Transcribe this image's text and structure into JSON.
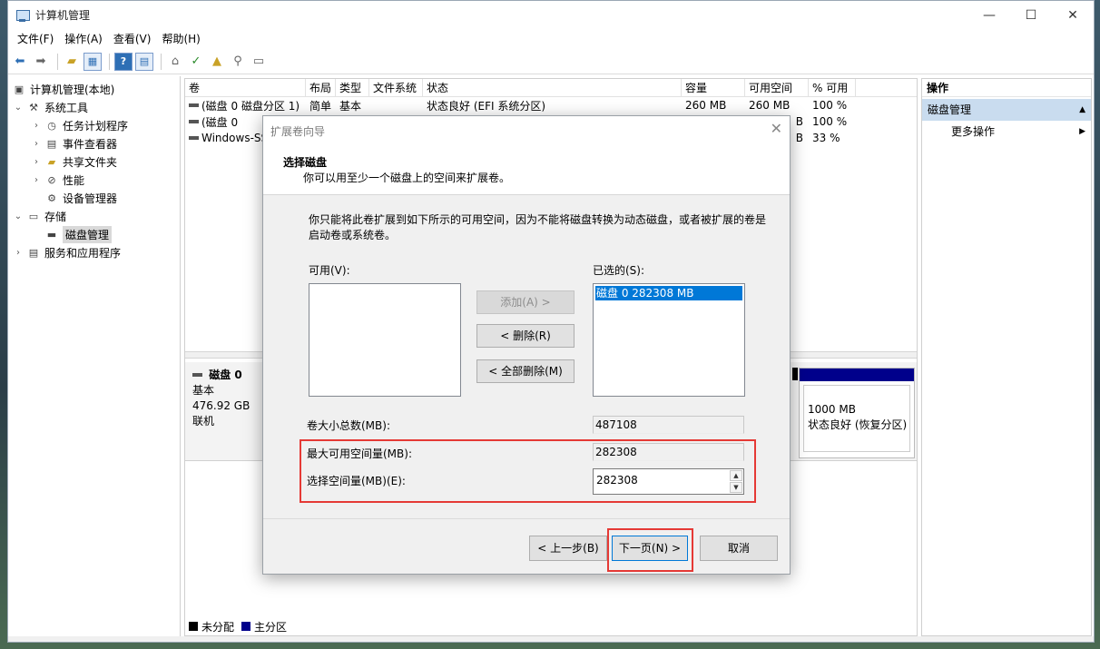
{
  "window": {
    "title": "计算机管理",
    "controls": {
      "minimize": "—",
      "maximize": "☐",
      "close": "✕"
    }
  },
  "menu": [
    "文件(F)",
    "操作(A)",
    "查看(V)",
    "帮助(H)"
  ],
  "toolbar": {
    "icons": [
      "back-icon",
      "forward-icon",
      "up-folder-icon",
      "show-hide-tree-icon",
      "help-icon",
      "properties-icon",
      "connect-icon",
      "check-icon",
      "arrow-up-icon",
      "search-icon",
      "console-icon"
    ]
  },
  "tree": {
    "root": "计算机管理(本地)",
    "system_tools": "系统工具",
    "task_scheduler": "任务计划程序",
    "event_viewer": "事件查看器",
    "shared_folders": "共享文件夹",
    "performance": "性能",
    "device_manager": "设备管理器",
    "storage": "存储",
    "disk_management": "磁盘管理",
    "services_apps": "服务和应用程序"
  },
  "volumes": {
    "columns": [
      "卷",
      "布局",
      "类型",
      "文件系统",
      "状态",
      "容量",
      "可用空间",
      "% 可用"
    ],
    "rows": [
      {
        "volume": "(磁盘 0 磁盘分区 1)",
        "layout": "简单",
        "type": "基本",
        "fs": "",
        "status": "状态良好 (EFI 系统分区)",
        "capacity": "260 MB",
        "free": "260 MB",
        "pct": "100 %"
      },
      {
        "volume": "(磁盘 0",
        "layout": "",
        "type": "",
        "fs": "",
        "status": "",
        "capacity": "",
        "free": "B",
        "pct": "100 %"
      },
      {
        "volume": "Windows-SS",
        "layout": "",
        "type": "",
        "fs": "",
        "status": "",
        "capacity": "",
        "free": "B",
        "pct": "33 %"
      }
    ]
  },
  "disk": {
    "name": "磁盘 0",
    "type": "基本",
    "size": "476.92 GB",
    "state": "联机",
    "partition_size": "1000 MB",
    "partition_status": "状态良好 (恢复分区)"
  },
  "legend": {
    "unallocated": "未分配",
    "primary": "主分区",
    "unallocated_color": "#000000",
    "primary_color": "#00008b"
  },
  "actions": {
    "header": "操作",
    "section": "磁盘管理",
    "more": "更多操作"
  },
  "dialog": {
    "title": "扩展卷向导",
    "heading": "选择磁盘",
    "subheading": "你可以用至少一个磁盘上的空间来扩展卷。",
    "description": "你只能将此卷扩展到如下所示的可用空间，因为不能将磁盘转换为动态磁盘，或者被扩展的卷是启动卷或系统卷。",
    "available_label": "可用(V):",
    "selected_label": "已选的(S):",
    "selected_item": "磁盘 0     282308 MB",
    "add_button": "添加(A) >",
    "remove_button": "< 删除(R)",
    "remove_all_button": "< 全部删除(M)",
    "total_label": "卷大小总数(MB):",
    "total_value": "487108",
    "max_label": "最大可用空间量(MB):",
    "max_value": "282308",
    "amount_label": "选择空间量(MB)(E):",
    "amount_value": "282308",
    "back_button": "< 上一步(B)",
    "next_button": "下一页(N) >",
    "cancel_button": "取消",
    "highlight_color": "#e53935"
  }
}
